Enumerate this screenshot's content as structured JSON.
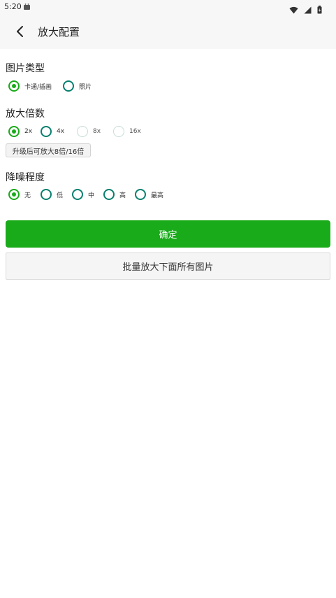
{
  "status_bar": {
    "time": "5:20",
    "icons": [
      "android-icon",
      "wifi-icon",
      "signal-icon",
      "battery-icon"
    ]
  },
  "app_bar": {
    "back_icon": "chevron-left-icon",
    "title": "放大配置"
  },
  "image_type": {
    "title": "图片类型",
    "options": [
      {
        "label": "卡通/插画",
        "checked": true
      },
      {
        "label": "照片",
        "checked": false
      }
    ]
  },
  "scale": {
    "title": "放大倍数",
    "options": [
      {
        "label": "2x",
        "checked": true,
        "enabled": true
      },
      {
        "label": "4x",
        "checked": false,
        "enabled": true
      },
      {
        "label": "8x",
        "checked": false,
        "enabled": false
      },
      {
        "label": "16x",
        "checked": false,
        "enabled": false
      }
    ],
    "upgrade_label": "升级后可放大8倍/16倍"
  },
  "denoise": {
    "title": "降噪程度",
    "options": [
      {
        "label": "无",
        "checked": true
      },
      {
        "label": "低",
        "checked": false
      },
      {
        "label": "中",
        "checked": false
      },
      {
        "label": "高",
        "checked": false
      },
      {
        "label": "最高",
        "checked": false
      }
    ]
  },
  "actions": {
    "confirm_label": "确定",
    "batch_label": "批量放大下面所有图片"
  },
  "colors": {
    "accent": "#1aab1a",
    "radio_unchecked": "#077f6f",
    "disabled": "#c7dcda"
  }
}
